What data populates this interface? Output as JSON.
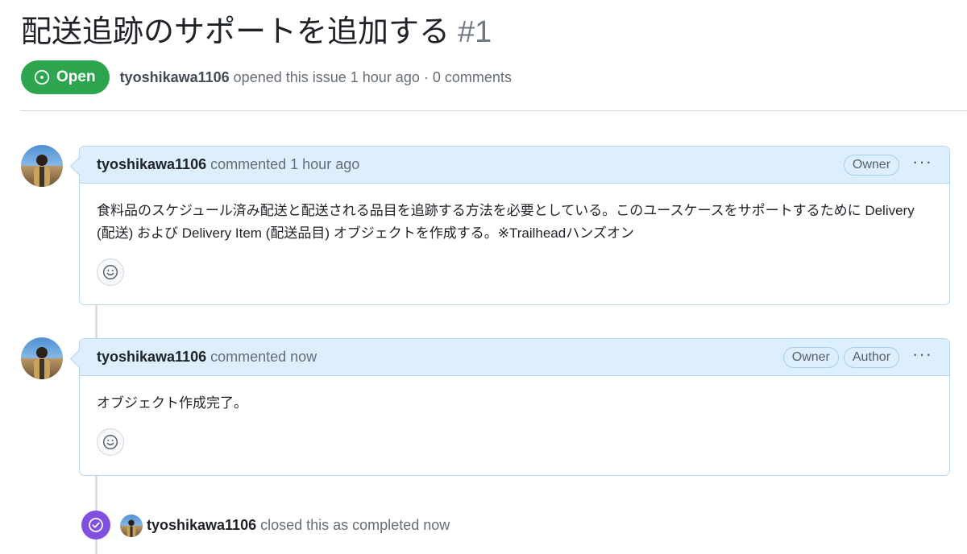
{
  "issue": {
    "title": "配送追跡のサポートを追加する",
    "number": "#1",
    "state_label": "Open",
    "state_color": "#2da44e",
    "author": "tyoshikawa1106",
    "meta_text": "opened this issue 1 hour ago · 0 comments"
  },
  "comments": [
    {
      "author": "tyoshikawa1106",
      "action": "commented 1 hour ago",
      "labels": [
        "Owner"
      ],
      "body": "食料品のスケジュール済み配送と配送される品目を追跡する方法を必要としている。このユースケースをサポートするために Delivery (配送) および Delivery Item (配送品目) オブジェクトを作成する。※Trailheadハンズオン",
      "more_icon": "kebab-horizontal-icon",
      "reaction_icon": "smiley-icon"
    },
    {
      "author": "tyoshikawa1106",
      "action": "commented now",
      "labels": [
        "Owner",
        "Author"
      ],
      "body": "オブジェクト作成完了。",
      "more_icon": "kebab-horizontal-icon",
      "reaction_icon": "smiley-icon"
    }
  ],
  "event": {
    "icon": "check-circle-icon",
    "icon_color": "#8250df",
    "author": "tyoshikawa1106",
    "text": "closed this as completed now"
  },
  "colors": {
    "header_bg": "#ddeffc",
    "border": "#b6d6f0",
    "text_muted": "#656d76"
  }
}
